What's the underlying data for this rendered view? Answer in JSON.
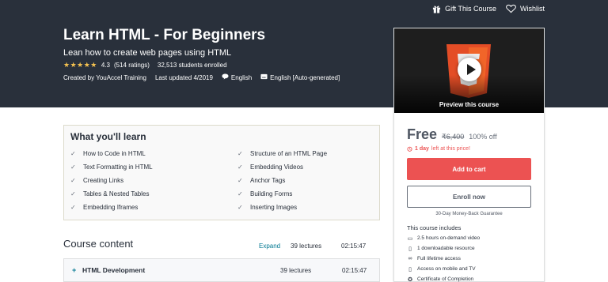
{
  "header": {
    "gift_label": "Gift This Course",
    "wishlist_label": "Wishlist"
  },
  "course": {
    "title": "Learn HTML - For Beginners",
    "subtitle": "Lean how to create web pages using HTML",
    "rating": "4.3",
    "ratings_count": "(514 ratings)",
    "students": "32,513 students enrolled",
    "created_by": "Created by YouAccel Training",
    "last_updated": "Last updated 4/2019",
    "language": "English",
    "captions": "English [Auto-generated]",
    "star_value": 4.3
  },
  "sidebar": {
    "preview_label": "Preview this course",
    "price": "Free",
    "original_price": "₹6,400",
    "discount": "100% off",
    "timer_bold": "1 day",
    "timer_rest": "left at this price!",
    "add_to_cart": "Add to cart",
    "enroll": "Enroll now",
    "guarantee": "30-Day Money-Back Guarantee",
    "includes_title": "This course includes",
    "includes": [
      {
        "icon": "video-icon",
        "glyph": "▭",
        "label": "2.5 hours on-demand video"
      },
      {
        "icon": "file-icon",
        "glyph": "▯",
        "label": "1 downloadable resource"
      },
      {
        "icon": "infinity-icon",
        "glyph": "∞",
        "label": "Full lifetime access"
      },
      {
        "icon": "mobile-icon",
        "glyph": "▯",
        "label": "Access on mobile and TV"
      },
      {
        "icon": "certificate-icon",
        "glyph": "✪",
        "label": "Certificate of Completion"
      }
    ]
  },
  "learn": {
    "title": "What you'll learn",
    "left": [
      "How to Code in HTML",
      "Text Formatting in HTML",
      "Creating Links",
      "Tables & Nested Tables",
      "Embedding Iframes"
    ],
    "right": [
      "Structure of an HTML Page",
      "Embedding Videos",
      "Anchor Tags",
      "Building Forms",
      "Inserting Images"
    ]
  },
  "content": {
    "title": "Course content",
    "expand": "Expand",
    "lectures": "39 lectures",
    "duration": "02:15:47",
    "sections": [
      {
        "name": "HTML Development",
        "lectures": "39 lectures",
        "duration": "02:15:47"
      }
    ]
  },
  "colors": {
    "hero_bg": "#29303b",
    "accent_red": "#ec5252",
    "star": "#f4c150",
    "link": "#007791",
    "html5_orange": "#e44d26"
  }
}
